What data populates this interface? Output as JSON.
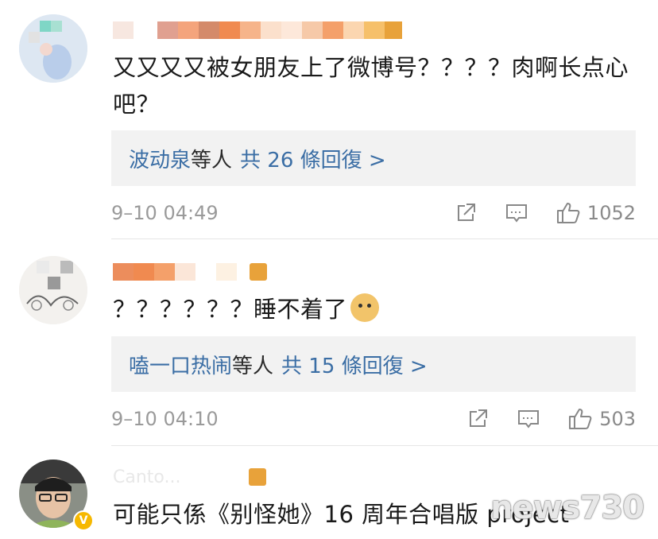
{
  "comments": [
    {
      "text": "又又又又被女朋友上了微博号？？？？肉啊长点心吧？",
      "replies": {
        "names": "波动泉",
        "suffix": "等人",
        "count_text": "共 26 條回復 >"
      },
      "date": "9–10 04:49",
      "likes": "1052"
    },
    {
      "text": "？？？？？？睡不着了",
      "replies": {
        "names": "嗑一口热闹",
        "suffix": "等人",
        "count_text": "共 15 條回復 >"
      },
      "date": "9–10 04:10",
      "likes": "503"
    },
    {
      "text": "可能只係《别怪她》16 周年合唱版 project",
      "username_partial": "Canto..."
    }
  ],
  "watermark": "news730",
  "colors": {
    "link": "#3b6ea5",
    "reply_bg": "#f2f2f2",
    "meta": "#9a9a9a"
  },
  "icons": [
    "share-icon",
    "comment-icon",
    "like-icon"
  ]
}
